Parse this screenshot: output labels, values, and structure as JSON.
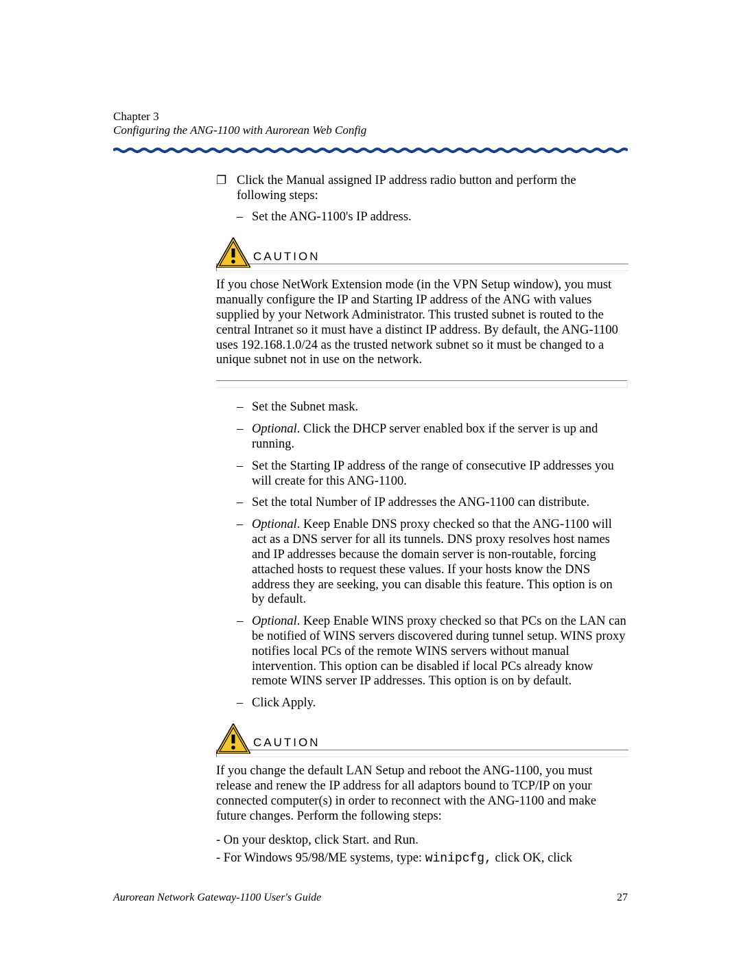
{
  "header": {
    "chapter_line": "Chapter 3",
    "subtitle": "Configuring the ANG-1100 with Aurorean Web Config"
  },
  "intro": {
    "bullet_symbol": "❐",
    "bullet_text": "Click the Manual assigned IP address radio button and perform the following steps:",
    "first_dash": "Set the ANG-1100's IP address."
  },
  "caution1": {
    "label": "CAUTION",
    "body": "If you chose NetWork Extension mode (in the VPN Setup window), you must manually configure the IP and Starting IP address of the ANG with values supplied by your Network Administrator. This trusted subnet is routed to the central Intranet so it must have a distinct IP address. By default, the ANG-1100 uses 192.168.1.0/24 as the trusted network subnet so it must be changed to a unique subnet not in use on the network."
  },
  "steps": {
    "s1": "Set the Subnet mask.",
    "s2_prefix": "Optional",
    "s2_rest": ". Click the DHCP server enabled box if the server is up and running.",
    "s3": "Set the Starting IP address of the range of consecutive IP addresses you will create for this ANG-1100.",
    "s4": "Set the total Number of IP addresses the ANG-1100 can distribute.",
    "s5_prefix": "Optional",
    "s5_rest": ". Keep Enable DNS proxy checked so that the ANG-1100 will act as a DNS server for all its tunnels. DNS proxy resolves host names and IP addresses because the domain server is non-routable, forcing attached hosts to request these values. If your hosts know the DNS address they are seeking, you can disable this feature. This option is on by default.",
    "s6_prefix": "Optional",
    "s6_rest": ". Keep Enable WINS proxy checked so that PCs on the LAN can be notified of WINS servers discovered during tunnel setup. WINS proxy notifies local PCs of the remote WINS servers without manual intervention. This option can be disabled if local PCs already know remote WINS server IP addresses. This option is on by default.",
    "s7": "Click Apply."
  },
  "caution2": {
    "label": "CAUTION",
    "body": "If you change the default LAN Setup and reboot the ANG-1100, you must release and renew the IP address for all adaptors bound to TCP/IP on your connected computer(s) in order to reconnect with the ANG-1100 and make future changes. Perform the following steps:",
    "l1": "- On your desktop, click Start. and Run.",
    "l2_pre": "- For Windows 95/98/ME systems, type: ",
    "l2_code": "winipcfg,",
    "l2_post": " click OK, click"
  },
  "footer": {
    "left": "Aurorean Network Gateway-1100 User's Guide",
    "right": "27"
  }
}
